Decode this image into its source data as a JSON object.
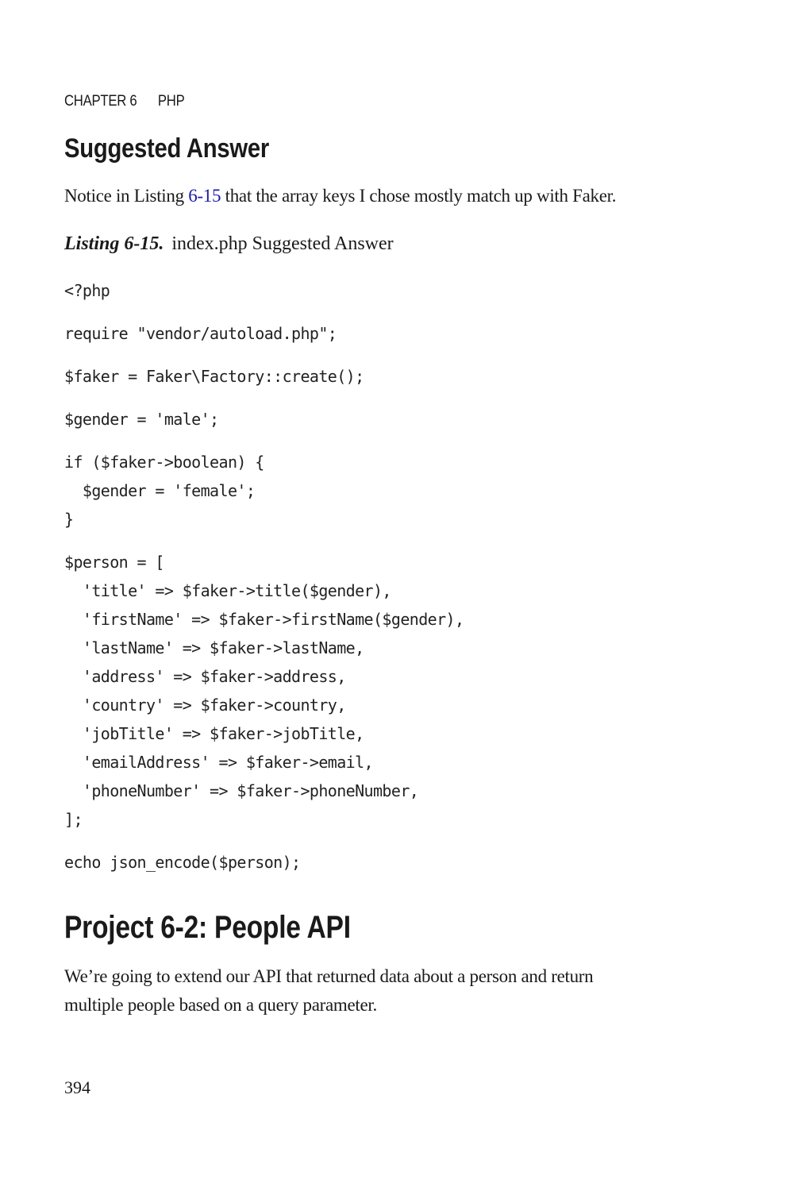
{
  "running_head": {
    "chapter": "CHAPTER 6",
    "title": "PHP"
  },
  "section_heading": "Suggested Answer",
  "intro": {
    "before": "Notice in Listing ",
    "link": "6-15",
    "after": " that the array keys I chose mostly match up with Faker."
  },
  "listing": {
    "label": "Listing 6-15.",
    "caption": "index.php Suggested Answer"
  },
  "code_blocks": [
    "<?php",
    "require \"vendor/autoload.php\";",
    "$faker = Faker\\Factory::create();",
    "$gender = 'male';",
    "if ($faker->boolean) {\n  $gender = 'female';\n}",
    "$person = [\n  'title' => $faker->title($gender),\n  'firstName' => $faker->firstName($gender),\n  'lastName' => $faker->lastName,\n  'address' => $faker->address,\n  'country' => $faker->country,\n  'jobTitle' => $faker->jobTitle,\n  'emailAddress' => $faker->email,\n  'phoneNumber' => $faker->phoneNumber,\n];",
    "echo json_encode($person);"
  ],
  "project_heading": "Project 6-2: People API",
  "project_text": "We’re going to extend our API that returned data about a person and return multiple people based on a query parameter.",
  "page_number": "394"
}
